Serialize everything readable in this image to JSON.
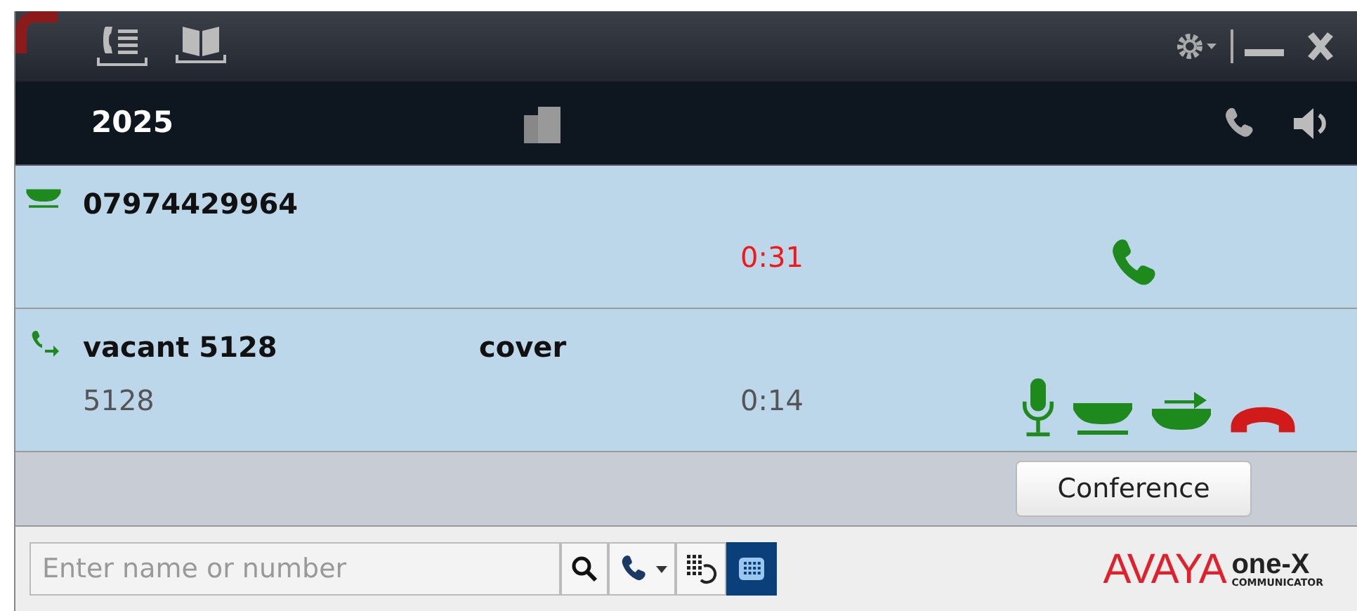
{
  "header": {
    "extension": "2025"
  },
  "calls": [
    {
      "kind": "incoming",
      "name": "07974429964",
      "timer": "0:31",
      "timer_alert": true
    },
    {
      "kind": "active",
      "name": "vacant 5128",
      "status": "cover",
      "number": "5128",
      "timer": "0:14",
      "timer_alert": false
    }
  ],
  "conference_button": "Conference",
  "search": {
    "placeholder": "Enter name or number"
  },
  "dialpad_selected": true,
  "logo": {
    "brand": "AVAYA",
    "product": "one-X",
    "subtitle": "COMMUNICATOR"
  }
}
